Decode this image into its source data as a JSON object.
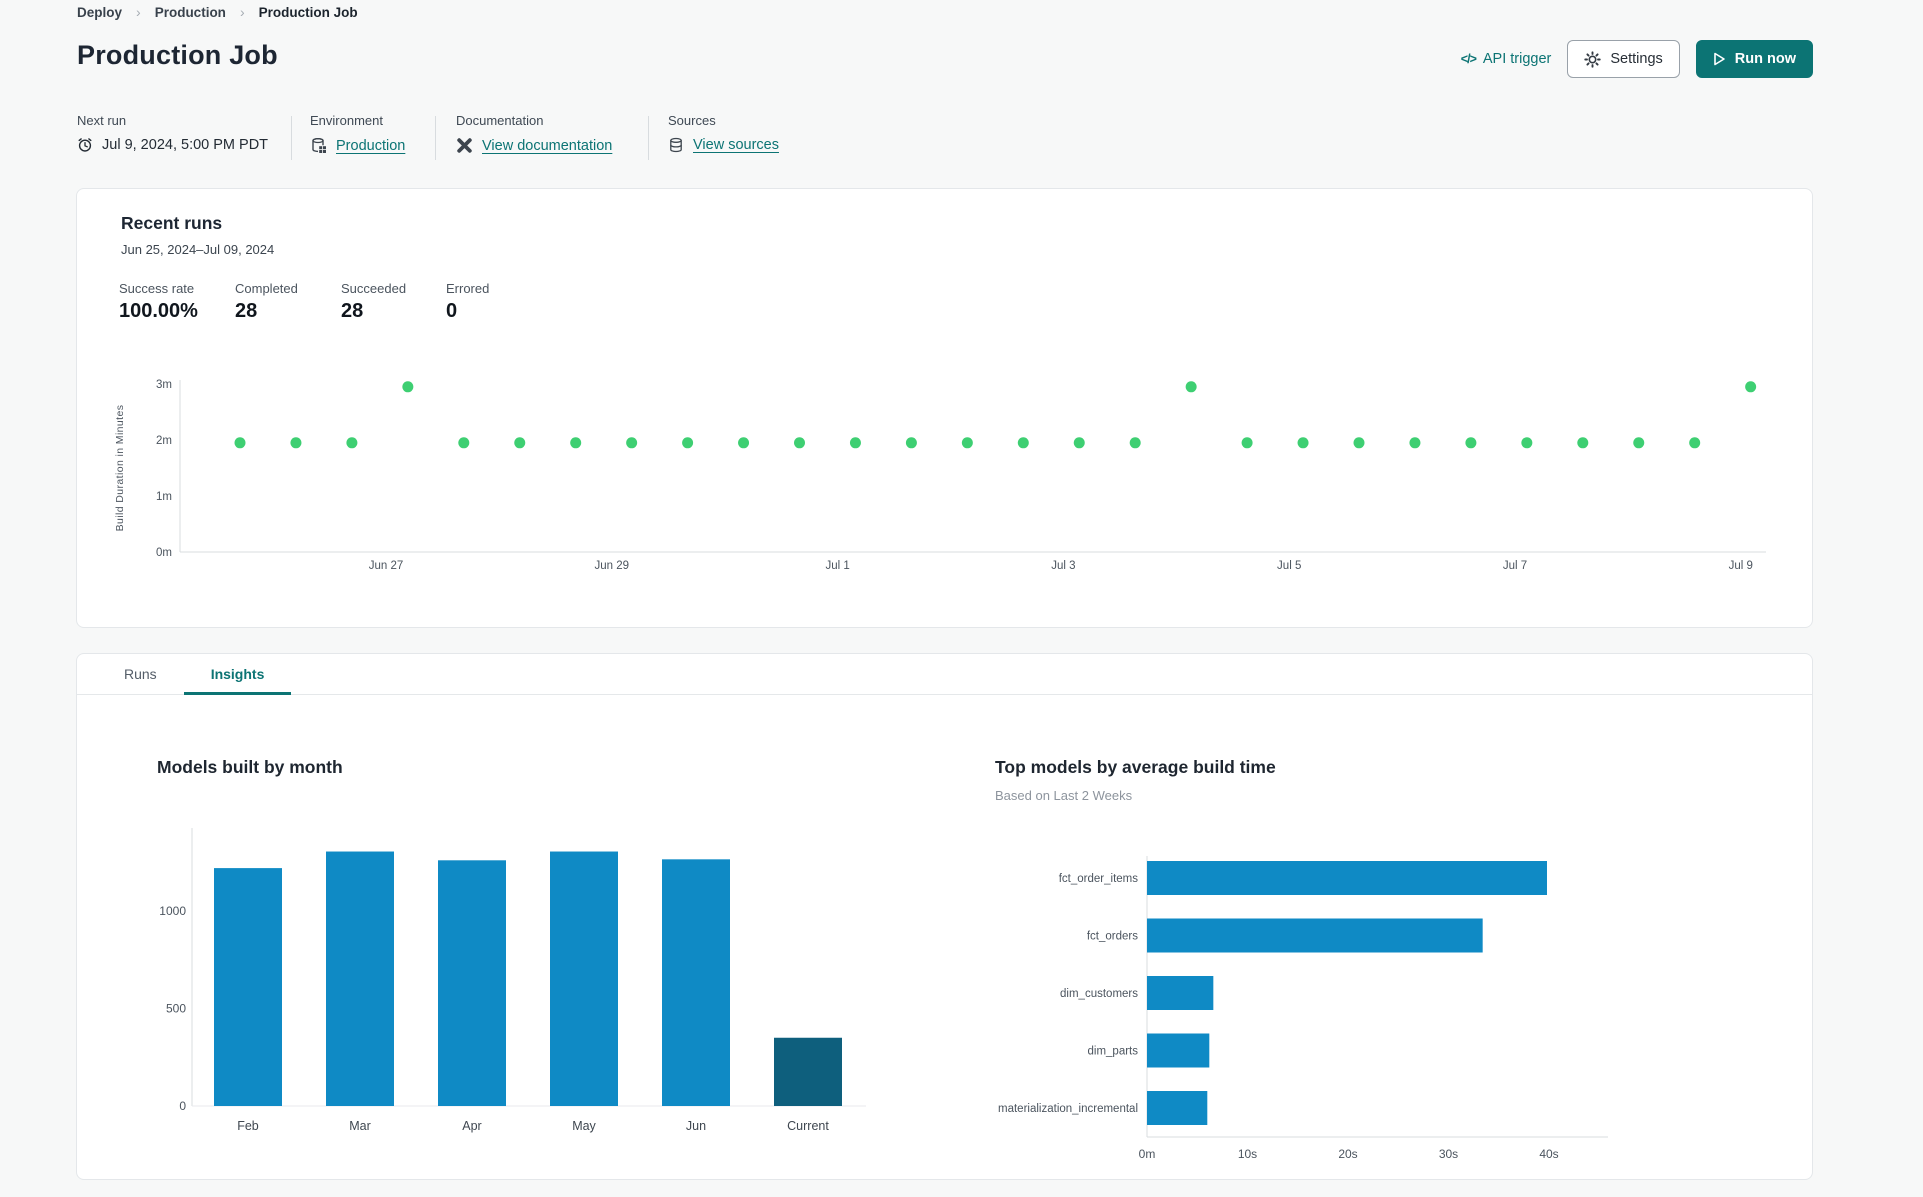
{
  "breadcrumb": {
    "items": [
      "Deploy",
      "Production",
      "Production Job"
    ],
    "separator": "›"
  },
  "page": {
    "title": "Production Job"
  },
  "header": {
    "api_trigger_label": "API trigger",
    "api_trigger_glyph": "</>",
    "settings_label": "Settings",
    "run_now_label": "Run now"
  },
  "info_bar": {
    "next_run": {
      "label": "Next run",
      "value": "Jul 9, 2024, 5:00 PM PDT"
    },
    "environment": {
      "label": "Environment",
      "value": "Production"
    },
    "documentation": {
      "label": "Documentation",
      "value": "View documentation"
    },
    "sources": {
      "label": "Sources",
      "value": "View sources"
    }
  },
  "recent_runs": {
    "title": "Recent runs",
    "date_range": "Jun 25, 2024–Jul 09, 2024",
    "stats": [
      {
        "label": "Success rate",
        "value": "100.00%"
      },
      {
        "label": "Completed",
        "value": "28"
      },
      {
        "label": "Succeeded",
        "value": "28"
      },
      {
        "label": "Errored",
        "value": "0"
      }
    ]
  },
  "tabs": [
    {
      "label": "Runs",
      "active": false
    },
    {
      "label": "Insights",
      "active": true
    }
  ],
  "colors": {
    "accent": "#0c7474",
    "success_dot": "#3ecf72",
    "bar_blue": "#0f8ac5",
    "bar_dark": "#0e5f7d",
    "axis_line": "#d9dcdf"
  },
  "chart_data": [
    {
      "type": "scatter",
      "name": "recent-run-build-durations",
      "ylabel": "Build Duration in Minutes",
      "yticks": [
        "0m",
        "1m",
        "2m",
        "3m"
      ],
      "ytick_minutes": [
        0,
        1,
        2,
        3
      ],
      "xticks": [
        "Jun 27",
        "Jun 29",
        "Jul 1",
        "Jul 3",
        "Jul 5",
        "Jul 7",
        "Jul 9"
      ],
      "points_minutes": [
        1.95,
        1.95,
        1.95,
        2.95,
        1.95,
        1.95,
        1.95,
        1.95,
        1.95,
        1.95,
        1.95,
        1.95,
        1.95,
        1.95,
        1.95,
        1.95,
        1.95,
        2.95,
        1.95,
        1.95,
        1.95,
        1.95,
        1.95,
        1.95,
        1.95,
        1.95,
        1.95,
        2.95
      ],
      "point_color": "#3ecf72",
      "grid": false
    },
    {
      "type": "bar",
      "title": "Models built by month",
      "categories": [
        "Feb",
        "Mar",
        "Apr",
        "May",
        "Jun",
        "Current"
      ],
      "values": [
        1220,
        1305,
        1260,
        1305,
        1265,
        350
      ],
      "bar_colors": [
        "#0f8ac5",
        "#0f8ac5",
        "#0f8ac5",
        "#0f8ac5",
        "#0f8ac5",
        "#0e5f7d"
      ],
      "yticks": [
        0,
        500,
        1000
      ],
      "ylim": [
        0,
        1400
      ],
      "xlabel": "",
      "ylabel": ""
    },
    {
      "type": "bar-horizontal",
      "title": "Top models by average build time",
      "subtitle": "Based on Last 2 Weeks",
      "categories": [
        "fct_order_items",
        "fct_orders",
        "dim_customers",
        "dim_parts",
        "materialization_incremental"
      ],
      "values_seconds": [
        39.8,
        33.4,
        6.6,
        6.2,
        6.0
      ],
      "bar_color": "#0f8ac5",
      "xticks": [
        "0m",
        "10s",
        "20s",
        "30s",
        "40s"
      ],
      "xtick_seconds": [
        0,
        10,
        20,
        30,
        40
      ],
      "xlim": [
        0,
        45
      ]
    }
  ]
}
